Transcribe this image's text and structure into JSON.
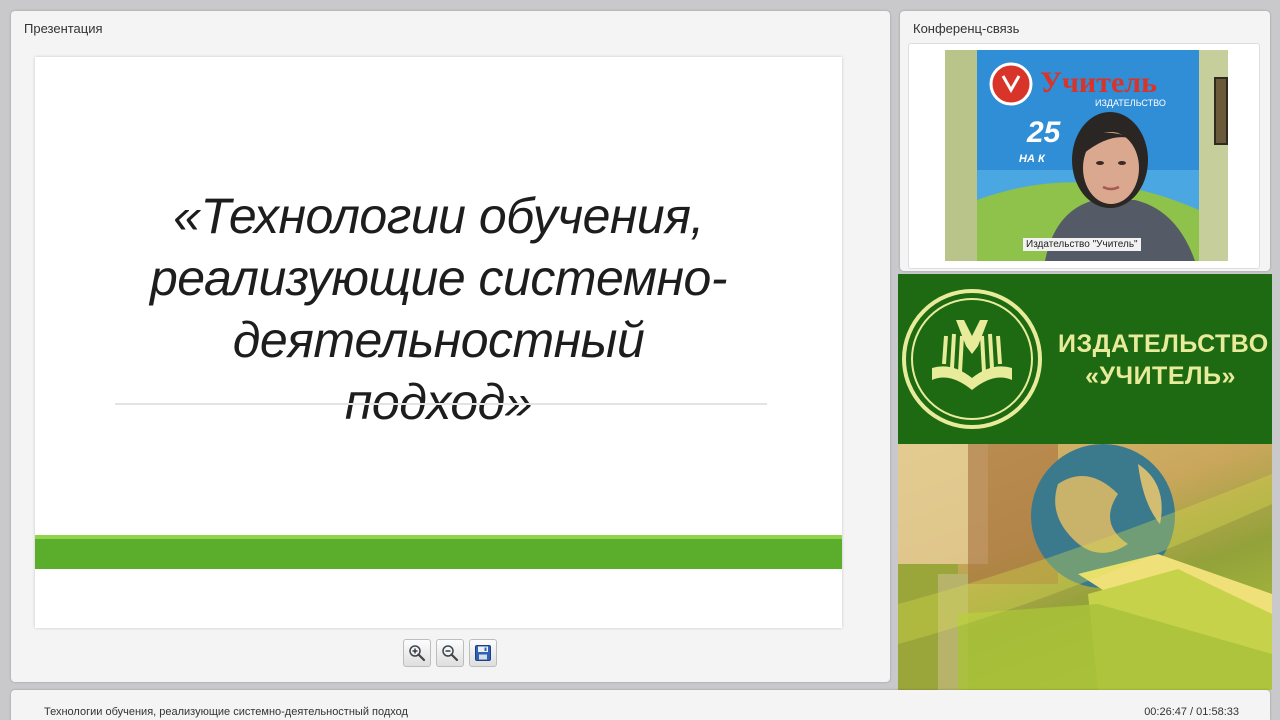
{
  "presentation": {
    "panel_title": "Презентация",
    "slide_title_lines": [
      "«Технологии обучения,",
      "реализующие системно-",
      "деятельностный",
      "подход»"
    ],
    "accent_green": "#5aae2c",
    "toolbar": {
      "zoom_in_icon": "zoom-in-icon",
      "zoom_out_icon": "zoom-out-icon",
      "save_icon": "floppy-disk-icon"
    }
  },
  "conference": {
    "panel_title": "Конференц-связь",
    "video_caption": "Издательство \"Учитель\"",
    "poster_text": "Учитель",
    "poster_subtext": "ИЗДАТЕЛЬСТВО",
    "poster_number": "25",
    "poster_small": "НА К"
  },
  "banner": {
    "line1": "ИЗДАТЕЛЬСТВО",
    "line2": "«УЧИТЕЛЬ»",
    "background": "#1d6a12",
    "text_color": "#e8ec9a"
  },
  "footer": {
    "title": "Технологии обучения, реализующие системно-деятельностный подход",
    "time": "00:26:47 / 01:58:33"
  }
}
